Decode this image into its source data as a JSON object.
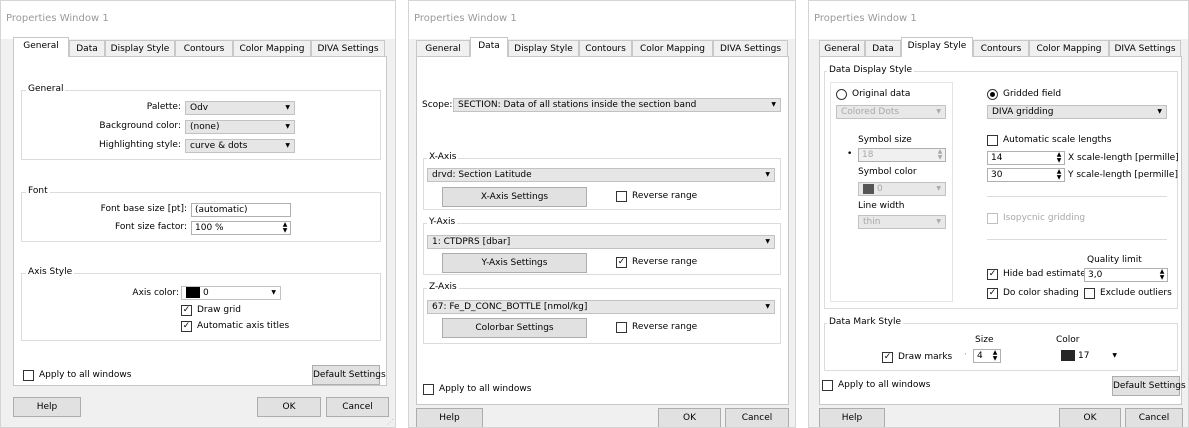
{
  "tabs": [
    "General",
    "Data",
    "Display Style",
    "Contours",
    "Color Mapping",
    "DIVA Settings"
  ],
  "common": {
    "apply_all": "Apply to all windows",
    "default_settings": "Default Settings",
    "help": "Help",
    "ok": "OK",
    "cancel": "Cancel"
  },
  "w1": {
    "title": "Properties Window 1",
    "general": {
      "title": "General",
      "palette_label": "Palette:",
      "palette_value": "Odv",
      "bg_label": "Background color:",
      "bg_value": "(none)",
      "hl_label": "Highlighting style:",
      "hl_value": "curve & dots"
    },
    "font": {
      "title": "Font",
      "base_label": "Font base size [pt]:",
      "base_value": "(automatic)",
      "factor_label": "Font size factor:",
      "factor_value": "100 %"
    },
    "axis": {
      "title": "Axis Style",
      "color_label": "Axis color:",
      "color_value": "0",
      "draw_grid": "Draw grid",
      "auto_titles": "Automatic axis titles"
    }
  },
  "w2": {
    "title": "Properties Window 1",
    "scope_label": "Scope:",
    "scope_value": "SECTION: Data of all stations inside the section band",
    "x": {
      "title": "X-Axis",
      "value": "drvd: Section Latitude",
      "button": "X-Axis Settings",
      "reverse": "Reverse range"
    },
    "y": {
      "title": "Y-Axis",
      "value": "1: CTDPRS [dbar]",
      "button": "Y-Axis Settings",
      "reverse": "Reverse range"
    },
    "z": {
      "title": "Z-Axis",
      "value": "67: Fe_D_CONC_BOTTLE [nmol/kg]",
      "button": "Colorbar Settings",
      "reverse": "Reverse range"
    }
  },
  "w3": {
    "title": "Properties Window 1",
    "dds": {
      "title": "Data Display Style",
      "original": "Original data",
      "colored_dots": "Colored Dots",
      "symbol_size_label": "Symbol size",
      "symbol_size_value": "18",
      "symbol_color_label": "Symbol color",
      "symbol_color_value": "0",
      "line_width_label": "Line width",
      "line_width_value": "thin",
      "gridded": "Gridded field",
      "diva": "DIVA gridding",
      "auto_scale": "Automatic scale lengths",
      "x_scale_value": "14",
      "x_scale_label": "X scale-length [permille]",
      "y_scale_value": "30",
      "y_scale_label": "Y scale-length [permille]",
      "isopycnic": "Isopycnic gridding",
      "quality_label": "Quality limit",
      "hide_bad": "Hide bad estimates",
      "quality_value": "3,0",
      "color_shading": "Do color shading",
      "exclude_outliers": "Exclude outliers"
    },
    "dms": {
      "title": "Data Mark Style",
      "size_label": "Size",
      "color_label": "Color",
      "draw_marks": "Draw marks",
      "size_value": "4",
      "color_value": "17"
    }
  },
  "colors": {
    "axis_color": "#000000",
    "symbol_color": "#555555",
    "mark_color": "#262626"
  }
}
